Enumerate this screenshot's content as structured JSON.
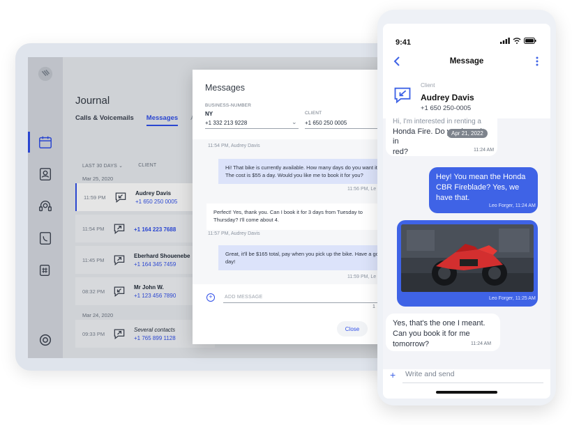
{
  "tablet": {
    "journal": {
      "title": "Journal",
      "tabs": [
        {
          "label": "Calls & Voicemails"
        },
        {
          "label": "Messages"
        },
        {
          "label": "All"
        }
      ],
      "filter_label": "LAST 30 DAYS",
      "client_column": "CLIENT",
      "groups": [
        {
          "date": "Mar 25, 2020",
          "rows": [
            {
              "time": "11:59 PM",
              "name": "Audrey Davis",
              "number": "+1 650 250 0005",
              "direction": "incoming"
            },
            {
              "time": "11:54 PM",
              "name": "",
              "number": "+1 164 223 7688",
              "direction": "outgoing"
            },
            {
              "time": "11:45 PM",
              "name": "Eberhard Shouenebe",
              "number": "+1 164 345 7459",
              "direction": "outgoing"
            },
            {
              "time": "08:32 PM",
              "name": "Mr John W.",
              "number": "+1 123 456 7890",
              "direction": "incoming"
            }
          ]
        },
        {
          "date": "Mar 24, 2020",
          "rows": [
            {
              "time": "09:33 PM",
              "name": "Several contacts",
              "number": "+1 765 899 1128",
              "direction": "outgoing"
            }
          ]
        }
      ]
    },
    "dialog": {
      "title": "Messages",
      "business_label": "BUSINESS-NUMBER",
      "business_city": "NY",
      "business_number": "+1 332 213 9228",
      "client_label": "CLIENT",
      "client_number": "+1 650 250 0005",
      "messages": [
        {
          "meta": "11:54 PM, Audrey Davis"
        },
        {
          "text": "Hi! That bike is currently available. How many days do you want it for? The cost is $55 a day. Would you like me to book it for you?",
          "stamp": "11:56 PM, Le"
        },
        {
          "text": "Perfect! Yes, thank you. Can I book it for 3 days from Tuesday to Thursday? I'll come about 4."
        },
        {
          "meta": "11:57 PM, Audrey Davis"
        },
        {
          "text": "Great, it'll be $165 total, pay when you pick up the bike. Have a good day!",
          "stamp": "11:59 PM, Le"
        }
      ],
      "compose_placeholder": "ADD MESSAGE",
      "char_count": "1",
      "close_label": "Close"
    }
  },
  "phone": {
    "status_time": "9:41",
    "nav_title": "Message",
    "client_label": "Client",
    "client_name": "Audrey Davis",
    "client_phone": "+1 650 250-0005",
    "date_pill": "Apr 21, 2022",
    "messages": [
      {
        "text_top": "Hi, I'm interested in renting a",
        "text_lines": [
          "Honda Fire. Do you have it in",
          "red?"
        ],
        "stamp": "11:24 AM",
        "direction": "incoming"
      },
      {
        "text": "Hey! You mean the Honda CBR Fireblade? Yes, we have that.",
        "stamp": "Leo Forger, 11:24 AM",
        "direction": "outgoing"
      },
      {
        "image": "red-motorcycle-photo",
        "stamp": "Leo Forger, 11:25 AM",
        "direction": "outgoing"
      },
      {
        "text": "Yes, that's the one I meant. Can you book it for me tomorrow?",
        "stamp": "11:24 AM",
        "direction": "incoming"
      }
    ],
    "compose_placeholder": "Write and send"
  },
  "colors": {
    "accent": "#3f63e6",
    "link": "#2f4ee8",
    "tablet_bg": "#e7eaef"
  }
}
